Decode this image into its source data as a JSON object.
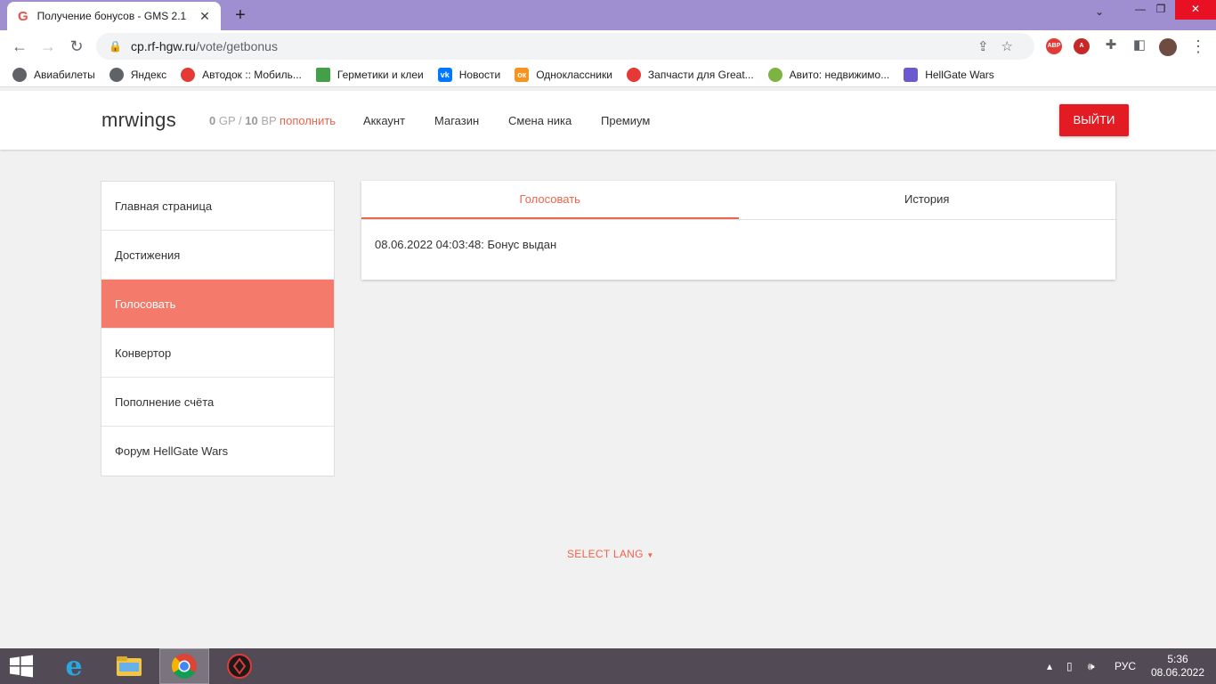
{
  "browser": {
    "tab_title": "Получение бонусов - GMS 2.1",
    "tab_favicon": "G",
    "url_host": "cp.rf-hgw.ru",
    "url_path": "/vote/getbonus",
    "bookmarks": [
      {
        "label": "Авиабилеты",
        "color": "#5f6368"
      },
      {
        "label": "Яндекс",
        "color": "#5f6368"
      },
      {
        "label": "Автодок :: Мобиль...",
        "color": "#e53935"
      },
      {
        "label": "Герметики и клеи",
        "color": "#43a047"
      },
      {
        "label": "Новости",
        "color": "#0077ff"
      },
      {
        "label": "Одноклассники",
        "color": "#f7931e"
      },
      {
        "label": "Запчасти для Great...",
        "color": "#e53935"
      },
      {
        "label": "Авито: недвижимо...",
        "color": "#7cb342"
      },
      {
        "label": "HellGate Wars",
        "color": "#6a5acd"
      }
    ],
    "ext_abp": "ABP"
  },
  "header": {
    "brand": "mrwings",
    "gp_value": "0",
    "gp_label": " GP / ",
    "bp_value": "10",
    "bp_label": " BP ",
    "topup": "пополнить",
    "nav": [
      "Аккаунт",
      "Магазин",
      "Смена ника",
      "Премиум"
    ],
    "logout": "ВЫЙТИ"
  },
  "sidebar": {
    "items": [
      {
        "label": "Главная страница",
        "active": false
      },
      {
        "label": "Достижения",
        "active": false
      },
      {
        "label": "Голосовать",
        "active": true
      },
      {
        "label": "Конвертор",
        "active": false
      },
      {
        "label": "Пополнение счёта",
        "active": false
      },
      {
        "label": "Форум HellGate Wars",
        "active": false
      }
    ]
  },
  "panel": {
    "tabs": [
      {
        "label": "Голосовать",
        "active": true
      },
      {
        "label": "История",
        "active": false
      }
    ],
    "message": "08.06.2022 04:03:48: Бонус выдан"
  },
  "footer": {
    "select_lang": "SELECT LANG"
  },
  "taskbar": {
    "lang": "РУС",
    "time": "5:36",
    "date": "08.06.2022"
  },
  "colors": {
    "accent": "#f0634c",
    "active_sidebar": "#f47b6b",
    "logout": "#e31b23",
    "tabstrip": "#9f8fd1"
  }
}
